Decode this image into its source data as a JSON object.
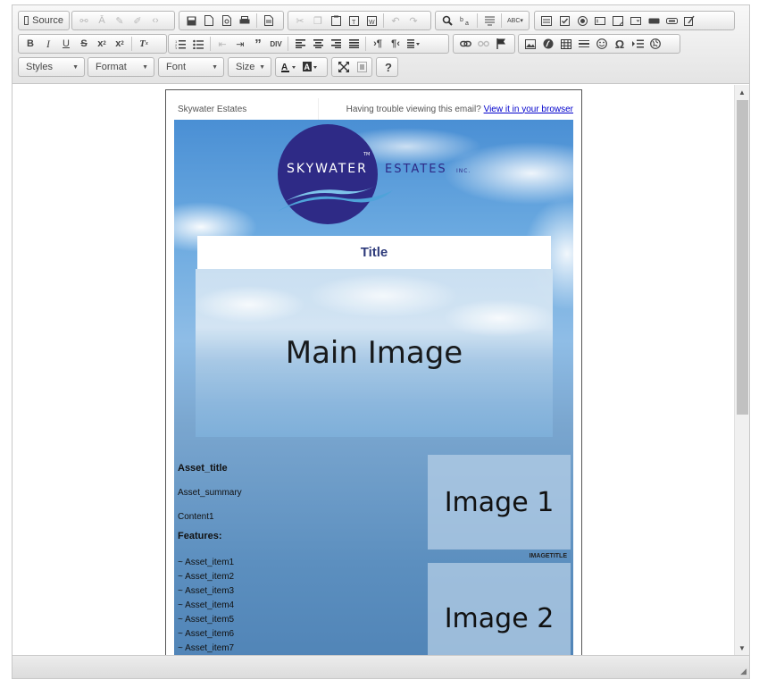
{
  "toolbar": {
    "row1": {
      "source_label": "Source"
    },
    "combos": {
      "styles": "Styles",
      "format": "Format",
      "font": "Font",
      "size": "Size"
    },
    "help_label": "?"
  },
  "email": {
    "header_brand": "Skywater Estates",
    "header_trouble": "Having trouble viewing this email?",
    "header_link": "View it in your browser",
    "logo_name": "SKYWATER",
    "logo_name2": "ESTATES",
    "logo_suffix": "INC.",
    "logo_tm": "TM",
    "title": "Title",
    "main_image_label": "Main Image",
    "asset_title": "Asset_title",
    "asset_summary": "Asset_summary",
    "content1": "Content1",
    "features_label": "Features:",
    "asset_items": [
      "~ Asset_item1",
      "~ Asset_item2",
      "~ Asset_item3",
      "~ Asset_item4",
      "~ Asset_item5",
      "~ Asset_item6",
      "~ Asset_item7"
    ],
    "image1_label": "Image 1",
    "image_caption": "IMAGETITLE",
    "image2_label": "Image 2"
  },
  "colors": {
    "logo_circle": "#2e2a86",
    "title_text": "#2d3a7a",
    "link": "#0000cc"
  }
}
